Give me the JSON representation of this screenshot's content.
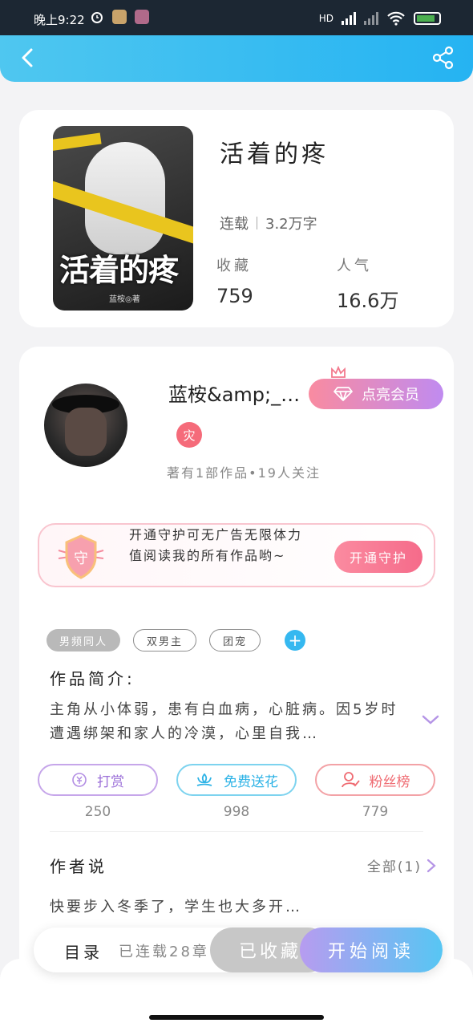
{
  "status_bar": {
    "time": "晚上9:22",
    "network": "HD",
    "battery": "83"
  },
  "header": {
    "back_icon": "back-arrow-icon",
    "share_icon": "share-icon"
  },
  "book": {
    "title": "活着的疼",
    "cover_title": "活着的疼",
    "cover_author": "蓝桉◎著",
    "status": "连载",
    "word_count": "3.2万字",
    "favorites_label": "收藏",
    "favorites_value": "759",
    "popularity_label": "人气",
    "popularity_value": "16.6万"
  },
  "author": {
    "name": "蓝桉&amp;_…",
    "vip_button": "点亮会员",
    "badge": "灾",
    "meta": "著有1部作品•19人关注"
  },
  "guard": {
    "icon_text": "守",
    "text": "开通守护可无广告无限体力值阅读我的所有作品哟~",
    "button": "开通守护"
  },
  "tags": {
    "items": [
      {
        "label": "男频同人",
        "style": "filled"
      },
      {
        "label": "双男主",
        "style": "outline"
      },
      {
        "label": "团宠",
        "style": "outline"
      }
    ],
    "add": "+"
  },
  "intro": {
    "title": "作品简介:",
    "text": "主角从小体弱，患有白血病，心脏病。因5岁时遭遇绑架和家人的冷漠，心里自我…"
  },
  "actions": [
    {
      "label": "打赏",
      "count": "250",
      "icon": "coin-icon"
    },
    {
      "label": "免费送花",
      "count": "998",
      "icon": "flower-icon"
    },
    {
      "label": "粉丝榜",
      "count": "779",
      "icon": "fans-icon"
    }
  ],
  "author_say": {
    "title": "作者说",
    "all_label": "全部(1)",
    "text": "快要步入冬季了，学生也大多开…"
  },
  "bottom": {
    "toc_label": "目录",
    "toc_count": "已连载28章",
    "collected": "已收藏",
    "read": "开始阅读"
  },
  "colors": {
    "header": "#25b3f2",
    "vip_gradient_start": "#f98ba0",
    "vip_gradient_end": "#c08bf0",
    "read_gradient_start": "#b79cf0",
    "read_gradient_end": "#57c6f3"
  }
}
